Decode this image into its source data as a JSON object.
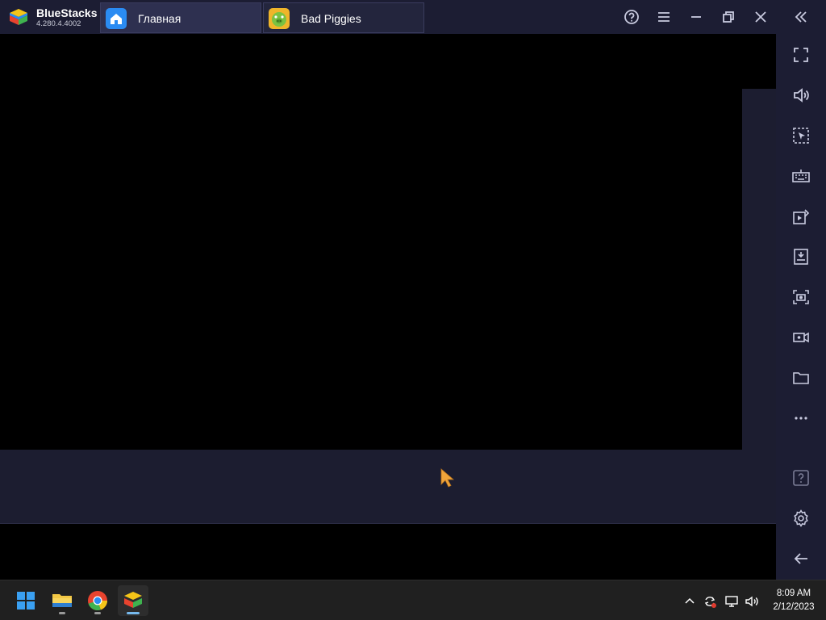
{
  "app": {
    "name": "BlueStacks",
    "version": "4.280.4.4002"
  },
  "tabs": [
    {
      "label": "Главная",
      "icon": "home-icon"
    },
    {
      "label": "Bad Piggies",
      "icon": "bad-piggies-app-icon"
    }
  ],
  "window_controls": [
    "help-icon",
    "menu-icon",
    "minimize-icon",
    "restore-icon",
    "close-icon",
    "collapse-sidebar-icon"
  ],
  "sidebar_tools": [
    "fullscreen-icon",
    "volume-icon",
    "pointer-select-icon",
    "keyboard-icon",
    "install-media-icon",
    "install-apk-icon",
    "screenshot-icon",
    "record-video-icon",
    "folder-icon",
    "more-icon",
    "help-box-icon",
    "settings-icon",
    "back-icon"
  ],
  "taskbar": {
    "apps": [
      "windows-start-icon",
      "file-explorer-icon",
      "chrome-icon",
      "bluestacks-icon"
    ],
    "tray": [
      "chevron-up-icon",
      "sync-icon",
      "network-icon",
      "speaker-icon"
    ],
    "time": "8:09 AM",
    "date": "2/12/2023"
  },
  "colors": {
    "titlebar": "#1c1d33",
    "tab_active": "#2e3050",
    "accent_blue": "#2a8bf2",
    "cursor": "#f0a43a"
  }
}
